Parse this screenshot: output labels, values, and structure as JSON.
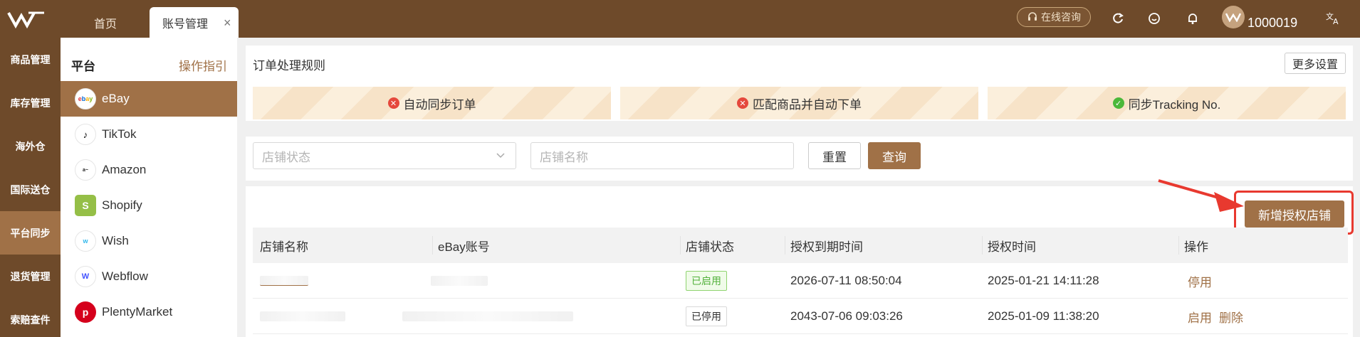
{
  "header": {
    "tabs": [
      {
        "label": "首页"
      },
      {
        "label": "账号管理",
        "close": "×"
      }
    ],
    "consult_label": "在线咨询",
    "user_id": "1000019"
  },
  "leftnav": {
    "items": [
      {
        "label": "商品管理"
      },
      {
        "label": "库存管理"
      },
      {
        "label": "海外仓"
      },
      {
        "label": "国际送仓"
      },
      {
        "label": "平台同步",
        "active": true
      },
      {
        "label": "退货管理"
      },
      {
        "label": "索赔查件"
      }
    ]
  },
  "platform": {
    "title": "平台",
    "guide_label": "操作指引",
    "items": [
      {
        "label": "eBay",
        "icon": "ebay-icon",
        "active": true
      },
      {
        "label": "TikTok",
        "icon": "tiktok-icon"
      },
      {
        "label": "Amazon",
        "icon": "amazon-icon"
      },
      {
        "label": "Shopify",
        "icon": "shopify-icon"
      },
      {
        "label": "Wish",
        "icon": "wish-icon"
      },
      {
        "label": "Webflow",
        "icon": "webflow-icon"
      },
      {
        "label": "PlentyMarket",
        "icon": "plentymarket-icon"
      }
    ]
  },
  "rules": {
    "title": "订单处理规则",
    "more_label": "更多设置",
    "items": [
      {
        "label": "自动同步订单",
        "status": "off"
      },
      {
        "label": "匹配商品并自动下单",
        "status": "off"
      },
      {
        "label": "同步Tracking No.",
        "status": "on"
      }
    ]
  },
  "filters": {
    "status_placeholder": "店铺状态",
    "name_placeholder": "店铺名称",
    "reset_label": "重置",
    "query_label": "查询"
  },
  "table": {
    "add_label": "新增授权店铺",
    "columns": [
      "店铺名称",
      "eBay账号",
      "店铺状态",
      "授权到期时间",
      "授权时间",
      "操作"
    ],
    "rows": [
      {
        "status": "已启用",
        "expire": "2026-07-11 08:50:04",
        "authorized": "2025-01-21 14:11:28",
        "actions": [
          "停用"
        ]
      },
      {
        "status": "已停用",
        "expire": "2043-07-06 09:03:26",
        "authorized": "2025-01-09 11:38:20",
        "actions": [
          "启用",
          "删除"
        ]
      }
    ]
  },
  "colors": {
    "brand_dark": "#6e4a2a",
    "brand": "#a07147",
    "danger": "#e5483c",
    "success": "#4bb83a"
  }
}
